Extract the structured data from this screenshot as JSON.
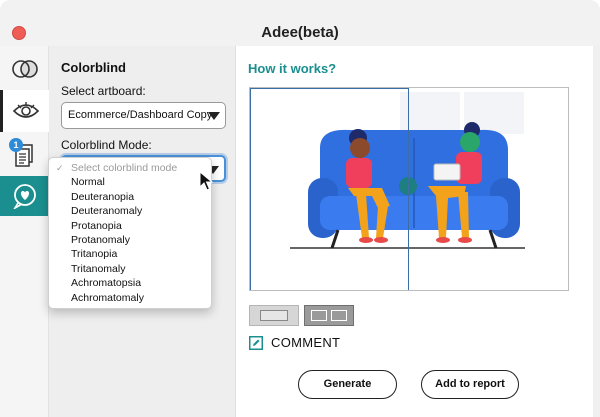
{
  "window": {
    "title": "Adee(beta)"
  },
  "rail": {
    "items": [
      {
        "name": "color-contrast",
        "icon": "overlap-circles-icon"
      },
      {
        "name": "colorblind",
        "icon": "eye-icon",
        "active": true
      },
      {
        "name": "reports",
        "icon": "documents-icon",
        "badge": "1"
      },
      {
        "name": "feedback",
        "icon": "heart-chat-icon"
      }
    ]
  },
  "panel": {
    "title": "Colorblind",
    "artboard_label": "Select artboard:",
    "artboard_value": "Ecommerce/Dashboard Copy",
    "mode_label": "Colorblind Mode:",
    "mode_options": [
      "Select colorblind mode",
      "Normal",
      "Deuteranopia",
      "Deuteranomaly",
      "Protanopia",
      "Protanomaly",
      "Tritanopia",
      "Tritanomaly",
      "Achromatopsia",
      "Achromatomaly"
    ]
  },
  "main": {
    "heading": "How it works?",
    "comment_label": "COMMENT",
    "generate_label": "Generate",
    "add_report_label": "Add to report"
  },
  "colors": {
    "accent_teal": "#1b8f8f",
    "sofa_blue": "#2f6fe0",
    "close_red": "#ee5e55"
  }
}
